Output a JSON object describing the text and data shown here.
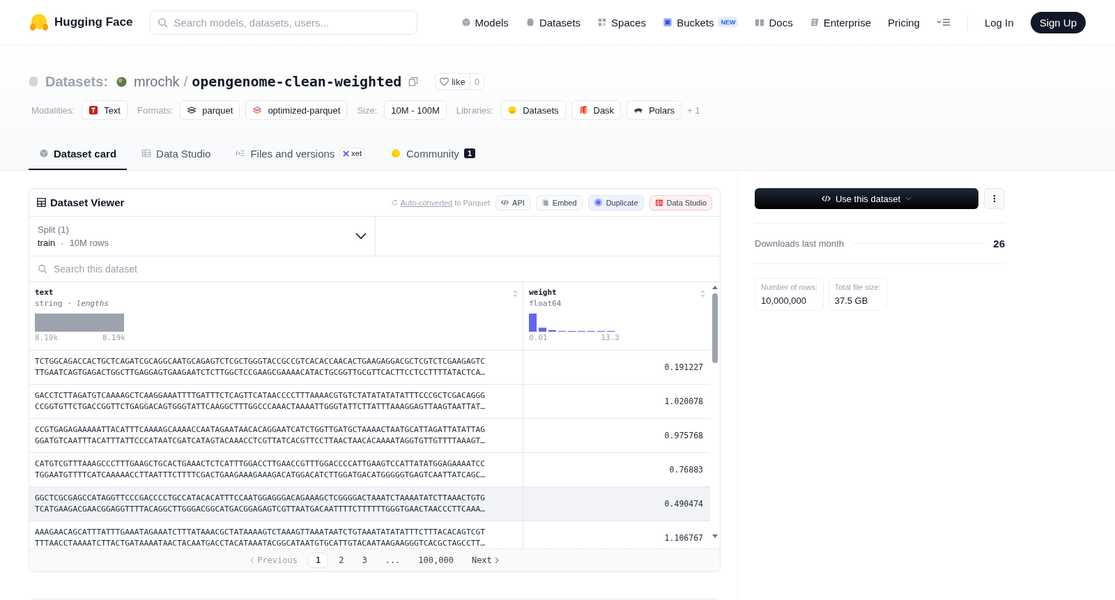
{
  "nav": {
    "brand": "Hugging Face",
    "search_placeholder": "Search models, datasets, users...",
    "links": [
      {
        "label": "Models"
      },
      {
        "label": "Datasets"
      },
      {
        "label": "Spaces"
      },
      {
        "label": "Buckets",
        "badge": "NEW"
      },
      {
        "label": "Docs"
      },
      {
        "label": "Enterprise"
      },
      {
        "label": "Pricing"
      }
    ],
    "login": "Log In",
    "signup": "Sign Up"
  },
  "repo": {
    "type_label": "Datasets:",
    "owner": "mrochk",
    "separator": "/",
    "name": "opengenome-clean-weighted",
    "like_label": "like",
    "likes": "0"
  },
  "tag_groups": [
    {
      "label": "Modalities:",
      "items": [
        {
          "text": "Text"
        }
      ]
    },
    {
      "label": "Formats:",
      "items": [
        {
          "text": "parquet"
        },
        {
          "text": "optimized-parquet"
        }
      ]
    },
    {
      "label": "Size:",
      "items": [
        {
          "text": "10M - 100M"
        }
      ]
    },
    {
      "label": "Libraries:",
      "items": [
        {
          "text": "Datasets"
        },
        {
          "text": "Dask"
        },
        {
          "text": "Polars"
        }
      ]
    }
  ],
  "more_tags": "+ 1",
  "tabs": [
    {
      "label": "Dataset card",
      "selected": true
    },
    {
      "label": "Data Studio",
      "selected": false
    },
    {
      "label": "Files and versions",
      "selected": false,
      "badge": "xet"
    },
    {
      "label": "Community",
      "selected": false,
      "count": "1"
    }
  ],
  "viewer": {
    "title": "Dataset Viewer",
    "note_link": "Auto-converted",
    "note_text": "to Parquet",
    "actions": [
      {
        "label": "API",
        "kind": "api"
      },
      {
        "label": "Embed",
        "kind": "embed"
      },
      {
        "label": "Duplicate",
        "kind": "duplicate"
      },
      {
        "label": "Data Studio",
        "kind": "studio"
      }
    ],
    "split": {
      "label": "Split (1)",
      "value": "train",
      "dot": "·",
      "rows": "10M rows"
    },
    "search_placeholder": "Search this dataset",
    "columns": [
      {
        "name": "text",
        "type": "string · *lengths*",
        "kind": "text",
        "min": "8.19k",
        "max": "8.19k"
      },
      {
        "name": "weight",
        "type": "float64",
        "kind": "number",
        "min": "0.01",
        "max": "13.3"
      }
    ],
    "rows": [
      {
        "hovered": false,
        "lines": [
          "TCTGGCAGACCACTGCTCAGATCGCAGGCAATGCAGAGTCTCGCTGGGTACCGCCGTCACACCAACACTGAAGAGGACGCTCGTCTCGAAGAGTC",
          "TTGAATCAGTGAGACTGGCTTGAGGAGTGAAGAATCTCTTGGCTCCGAAGCGAAAACATACTGCGGTTGCGTTCACTTCCTCCTTTTATACTCA…"
        ],
        "weight": "0.191227"
      },
      {
        "hovered": false,
        "lines": [
          "GACCTCTTAGATGTCAAAAGCTCAAGGAAATTTTGATTTCTCAGTTCATAACCCCTTTAAAACGTGTCTATATATATATTTCCCGCTCGACAGGG",
          "CCGGTGTTCTGACCGGTTCTGAGGACAGTGGGTATTCAAGGCTTTGGCCCAAACTAAAATTGGGTATTCTTATTTAAAGGAGTTAAGTAATTAT…"
        ],
        "weight": "1.020078"
      },
      {
        "hovered": false,
        "lines": [
          "CCGTGAGAGAAAAATTACATTTCAAAAGCAAAACCAATAGAATAACACAGGAATCATCTGGTTGATGCTAAAACTAATGCATTAGATTATATTAG",
          "GGATGTCAATTTACATTTATTCCCATAATCGATCATAGTACAAACCTCGTTATCACGTTCCTTAACTAACACAAAATAGGTGTTGTTTTAAAGT…"
        ],
        "weight": "0.975768"
      },
      {
        "hovered": false,
        "lines": [
          "CATGTCGTTTAAAGCCCTTTGAAGCTGCACTGAAACTCTCATTTGGACCTTGAACCGTTTGGACCCCATTGAAGTCCATTATATGGAGAAAATCC",
          "TGGAATGTTTTCATCAAAAACCTTAATTTCTTTTCGACTGAAGAAAGAAAGACATGGACATCTTGGATGACATGGGGGTGAGTCAATTATCAGC…"
        ],
        "weight": "0.76883"
      },
      {
        "hovered": true,
        "lines": [
          "GGCTCGCGAGCCATAGGTTCCCGACCCCTGCCATACACATTTCCAATGGAGGGACAGAAAGCTCGGGGACTAAATCTAAAATATCTTAAACTGTG",
          "TCATGAAGACGAACGGAGGTTTTACAGGCTTGGGACGGCATGACGGAGAGTCGTTAATGACAATTTTCTTTTTTGGGTGAACTAACCCTTCAAA…"
        ],
        "weight": "0.490474"
      },
      {
        "hovered": false,
        "lines": [
          "AAAGAACAGCATTTATTTGAAATAGAAATCTTTATAAACGCTATAAAAGTCTAAAGTTAAATAATCTGTAAATATATATTTCTTTACACAGTCGT",
          "TTTAACCTAAAATCTTACTGATAAAATAACTACAATGACCTACATAAATACGGCATAATGTGCATTGTACAATAAGAAGGGTCACGCTAGCCTT…"
        ],
        "weight": "1.106767"
      }
    ],
    "pagination": {
      "previous": {
        "label": "Previous",
        "disabled": true
      },
      "pages": [
        {
          "label": "1",
          "selected": true
        },
        {
          "label": "2",
          "selected": false
        },
        {
          "label": "3",
          "selected": false
        },
        {
          "label": "...",
          "selected": false
        },
        {
          "label": "100,000",
          "selected": false
        }
      ],
      "next": {
        "label": "Next",
        "disabled": false
      }
    }
  },
  "sidebar": {
    "use_button": "Use this dataset",
    "downloads_label": "Downloads last month",
    "downloads_value": "26",
    "stats": [
      {
        "label": "Number of rows:",
        "value": "10,000,000"
      },
      {
        "label": "Total file size:",
        "value": "37.5 GB"
      }
    ]
  }
}
